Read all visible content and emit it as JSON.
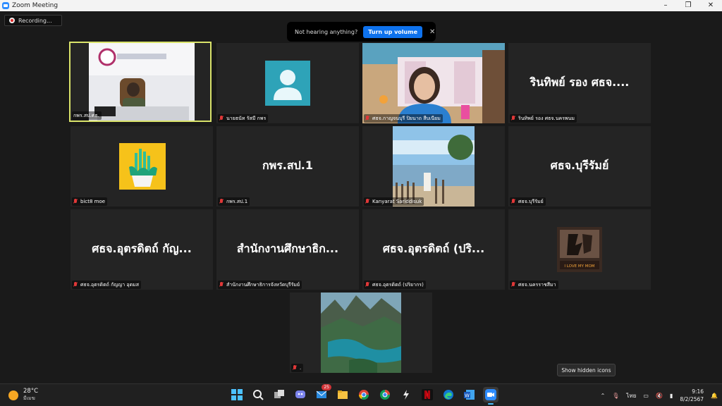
{
  "window": {
    "title": "Zoom Meeting",
    "minimize": "–",
    "maximize": "❐",
    "close": "✕"
  },
  "recording": {
    "label": "Recording..."
  },
  "notice": {
    "text": "Not hearing anything?",
    "button": "Turn up volume",
    "close": "✕"
  },
  "tiles": [
    {
      "name": "กพร.สป.ศธ.",
      "big": "",
      "kind": "video-office",
      "active": true
    },
    {
      "name": "นายธนัท รัสมี กพร",
      "big": "",
      "kind": "avatar"
    },
    {
      "name": "ศธจ.กาญจนบุรี ปิยนาถ สืบเนียม",
      "big": "",
      "kind": "video-woman"
    },
    {
      "name": "รินทิพย์ รอง ศธจ.นครพนม",
      "big": "รินทิพย์ รอง ศธจ....",
      "kind": "text"
    },
    {
      "name": "bict8 moe",
      "big": "",
      "kind": "plant"
    },
    {
      "name": "กพร.สป.1",
      "big": "กพร.สป.1",
      "kind": "text"
    },
    {
      "name": "Kanyarat Sariddisuk",
      "big": "",
      "kind": "beach"
    },
    {
      "name": "ศธจ.บุรีรัมย์",
      "big": "ศธจ.บุรีรัมย์",
      "kind": "text"
    },
    {
      "name": "ศธจ.อุตรดิตถ์ กัญญา อุดมส",
      "big": "ศธจ.อุตรดิตถ์ กัญ...",
      "kind": "text"
    },
    {
      "name": "สำนักงานศึกษาธิการจังหวัดบุรีรัมย์",
      "big": "สำนักงานศึกษาธิก...",
      "kind": "text"
    },
    {
      "name": "ศธจ.อุตรดิตถ์ (ปริยากร)",
      "big": "ศธจ.อุตรดิตถ์ (ปริ...",
      "kind": "text"
    },
    {
      "name": "ศธจ.นครราชสีมา",
      "big": "",
      "kind": "poster",
      "poster_caption": "I LOVE MY MOM"
    },
    {
      "name": ".",
      "big": "",
      "kind": "lake"
    }
  ],
  "tray_popup": {
    "label": "Show hidden icons"
  },
  "taskbar": {
    "weather_temp": "28°C",
    "weather_desc": "มีเมฆ",
    "mail_badge": "25",
    "lang": "ไทย",
    "time": "9:16",
    "date": "8/2/2567",
    "apps": [
      "windows-start-icon",
      "search-icon",
      "task-view-icon",
      "chat-icon",
      "mail-icon",
      "file-explorer-icon",
      "chrome-icon",
      "chrome-profile-icon",
      "app-icon",
      "netflix-icon",
      "edge-icon",
      "word-icon",
      "zoom-icon"
    ]
  },
  "colors": {
    "accent": "#0e72ed",
    "active_speaker": "#d9e36a",
    "muted": "#e03838",
    "avatar_bg": "#2ea3b8"
  }
}
